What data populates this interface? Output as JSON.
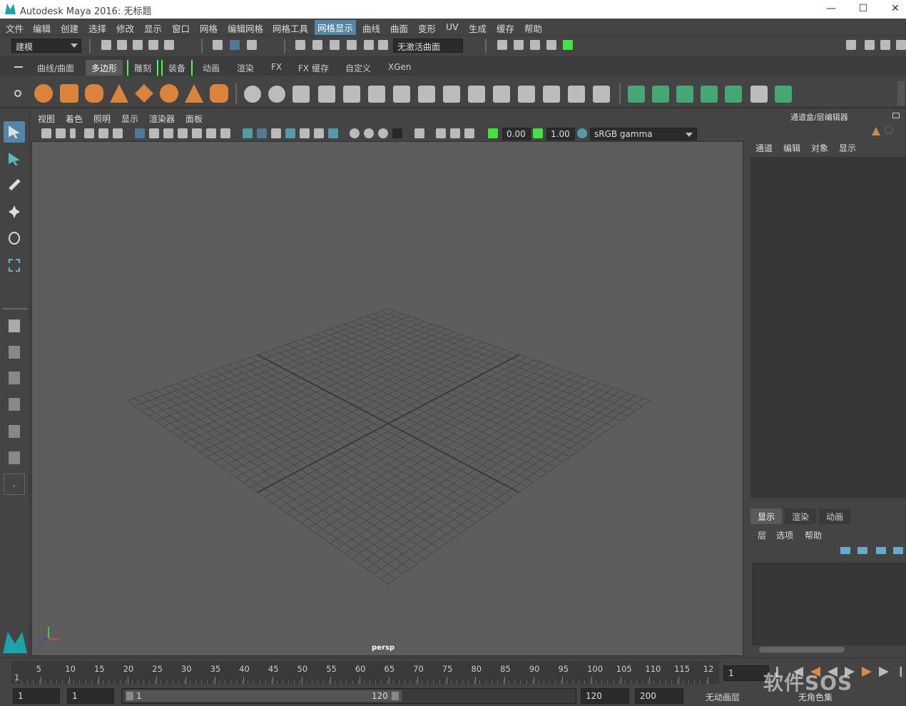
{
  "window": {
    "title": "Autodesk Maya 2016: 无标题",
    "minimize": "—",
    "maximize": "☐",
    "close": "✕"
  },
  "menubar": [
    "文件",
    "编辑",
    "创建",
    "选择",
    "修改",
    "显示",
    "窗口",
    "网格",
    "编辑网格",
    "网格工具",
    "网格显示",
    "曲线",
    "曲面",
    "变形",
    "UV",
    "生成",
    "缓存",
    "帮助"
  ],
  "menubar_selected": "网格显示",
  "status_line": {
    "mode": "建模",
    "live_surface": "无激活曲面"
  },
  "shelf_tabs": [
    "曲线/曲面",
    "多边形",
    "雕刻",
    "装备",
    "动画",
    "渲染",
    "FX",
    "FX 缓存",
    "自定义",
    "XGen"
  ],
  "shelf_active": "多边形",
  "viewport": {
    "menus": [
      "视图",
      "着色",
      "照明",
      "显示",
      "渲染器",
      "面板"
    ],
    "exposure": "0.00",
    "gamma": "1.00",
    "color_space": "sRGB gamma",
    "camera": "persp"
  },
  "channel_box": {
    "title": "通道盒/层编辑器",
    "menus": [
      "通道",
      "编辑",
      "对象",
      "显示"
    ]
  },
  "layer_editor": {
    "tabs": [
      "显示",
      "渲染",
      "动画"
    ],
    "active": "显示",
    "menus": [
      "层",
      "选项",
      "帮助"
    ]
  },
  "timeline": {
    "ticks": [
      "5",
      "10",
      "15",
      "20",
      "25",
      "30",
      "35",
      "40",
      "45",
      "50",
      "55",
      "60",
      "65",
      "70",
      "75",
      "80",
      "85",
      "90",
      "95",
      "100",
      "105",
      "110",
      "115",
      "12"
    ],
    "start_mark": "1",
    "current_frame": "1"
  },
  "range": {
    "start": "1",
    "anim_start": "1",
    "range_start": "1",
    "range_end": "120",
    "end": "120",
    "anim_end": "200",
    "anim_layer": "无动画层",
    "char_set": "无角色集"
  },
  "watermark": "软件SOS"
}
